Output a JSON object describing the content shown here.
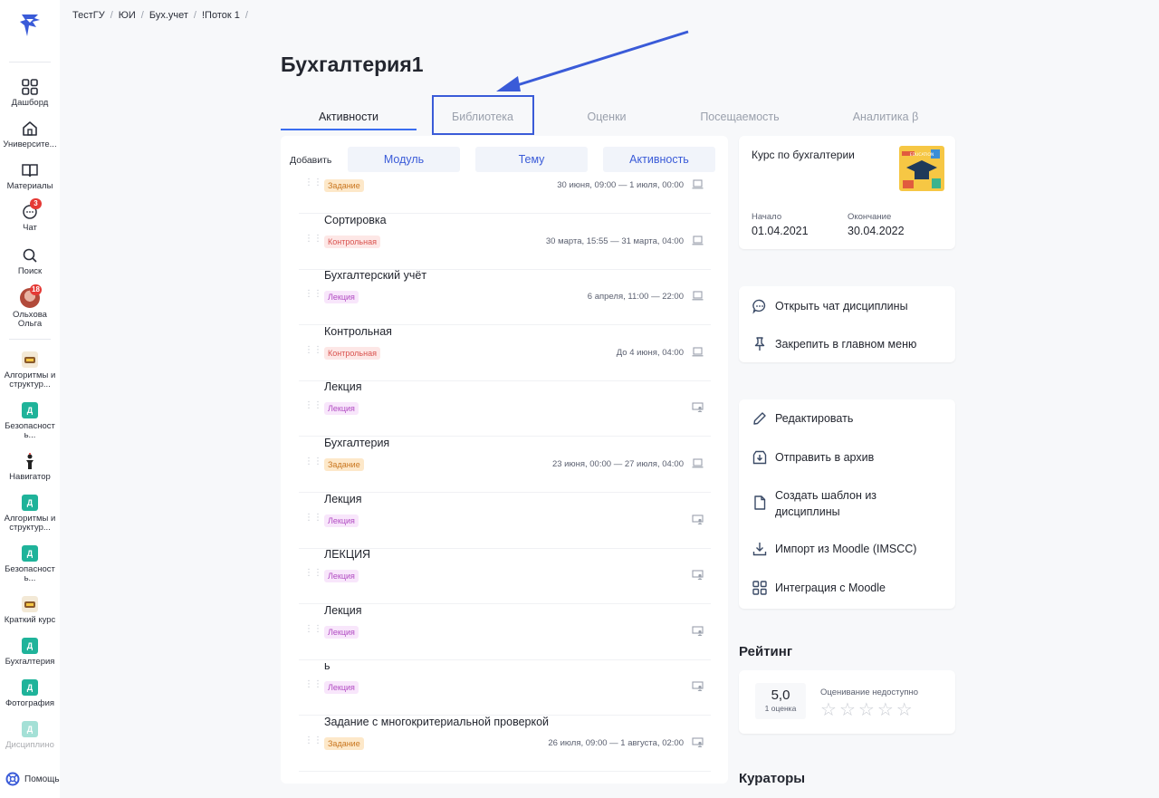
{
  "breadcrumb": [
    "ТестГУ",
    "ЮИ",
    "Бух.учет",
    "!Поток 1"
  ],
  "page_title": "Бухгалтерия1",
  "tabs": [
    {
      "label": "Активности",
      "active": true
    },
    {
      "label": "Библиотека",
      "active": false
    },
    {
      "label": "Оценки",
      "active": false
    },
    {
      "label": "Посещаемость",
      "active": false
    },
    {
      "label": "Аналитика β",
      "active": false
    }
  ],
  "add_row": {
    "label": "Добавить",
    "buttons": [
      "Модуль",
      "Тему",
      "Активность"
    ]
  },
  "sidebar": {
    "dashboard": "Дашборд",
    "university": "Университе...",
    "materials": "Материалы",
    "chat": "Чат",
    "chat_badge": "3",
    "search": "Поиск",
    "user_name_1": "Ольхова",
    "user_name_2": "Ольга",
    "user_badge": "18",
    "courses": [
      {
        "line1": "Алгоритмы и",
        "line2": "структур...",
        "icon": "photo",
        "letter": ""
      },
      {
        "line1": "Безопасност",
        "line2": "ь...",
        "icon": "square",
        "letter": "Д"
      },
      {
        "line1": "Навигатор",
        "line2": "",
        "icon": "person",
        "letter": ""
      },
      {
        "line1": "Алгоритмы и",
        "line2": "структур...",
        "icon": "square",
        "letter": "Д"
      },
      {
        "line1": "Безопасност",
        "line2": "ь...",
        "icon": "square",
        "letter": "Д"
      },
      {
        "line1": "Краткий курс",
        "line2": "",
        "icon": "photo",
        "letter": ""
      },
      {
        "line1": "Бухгалтерия",
        "line2": "",
        "icon": "square",
        "letter": "Д"
      },
      {
        "line1": "Фотография",
        "line2": "",
        "icon": "square",
        "letter": "Д"
      },
      {
        "line1": "Дисциплино",
        "line2": "",
        "icon": "square",
        "letter": "Д"
      }
    ],
    "help": "Помощь"
  },
  "activities": [
    {
      "title": "",
      "tag": "Задание",
      "tag_type": "task",
      "date": "30 июня, 09:00 — 1 июля, 00:00",
      "icon": "laptop"
    },
    {
      "title": "Сортировка",
      "tag": "Контрольная",
      "tag_type": "control",
      "date": "30 марта, 15:55 — 31 марта, 04:00",
      "icon": "laptop"
    },
    {
      "title": "Бухгалтерский учёт",
      "tag": "Лекция",
      "tag_type": "lecture",
      "date": "6 апреля, 11:00 — 22:00",
      "icon": "laptop"
    },
    {
      "title": "Контрольная",
      "tag": "Контрольная",
      "tag_type": "control",
      "date": "До 4 июня, 04:00",
      "icon": "laptop"
    },
    {
      "title": "Лекция",
      "tag": "Лекция",
      "tag_type": "lecture",
      "date": "",
      "icon": "person-screen"
    },
    {
      "title": "Бухгалтерия",
      "tag": "Задание",
      "tag_type": "task",
      "date": "23 июня, 00:00 — 27 июля, 04:00",
      "icon": "laptop"
    },
    {
      "title": "Лекция",
      "tag": "Лекция",
      "tag_type": "lecture",
      "date": "",
      "icon": "person-screen"
    },
    {
      "title": "ЛЕКЦИЯ",
      "tag": "Лекция",
      "tag_type": "lecture",
      "date": "",
      "icon": "person-screen"
    },
    {
      "title": "Лекция",
      "tag": "Лекция",
      "tag_type": "lecture",
      "date": "",
      "icon": "person-screen"
    },
    {
      "title": "ь",
      "tag": "Лекция",
      "tag_type": "lecture",
      "date": "",
      "icon": "person-screen"
    },
    {
      "title": "Задание с многокритериальной проверкой",
      "tag": "Задание",
      "tag_type": "task",
      "date": "26 июля, 09:00 — 1 августа, 02:00",
      "icon": "person-screen"
    }
  ],
  "course_card": {
    "name": "Курс по бухгалтерии",
    "image_text": "EDUCATION",
    "start_label": "Начало",
    "start_value": "01.04.2021",
    "end_label": "Окончание",
    "end_value": "30.04.2022"
  },
  "actions1": [
    "Открыть чат дисциплины",
    "Закрепить в главном меню"
  ],
  "actions2": {
    "edit": "Редактировать",
    "archive": "Отправить в архив",
    "template_1": "Создать шаблон из",
    "template_2": "дисциплины",
    "import": "Импорт из Moodle (IMSCC)",
    "integration": "Интеграция с Moodle"
  },
  "rating": {
    "title": "Рейтинг",
    "score": "5,0",
    "count": "1 оценка",
    "unavailable": "Оценивание недоступно",
    "stars": 5
  },
  "curators_title": "Кураторы",
  "colors": {
    "accent": "#3a5bd8",
    "control_tag": "#d9534f",
    "lecture_tag": "#b14bc2",
    "task_tag": "#c9761f",
    "badge": "#e53935"
  }
}
